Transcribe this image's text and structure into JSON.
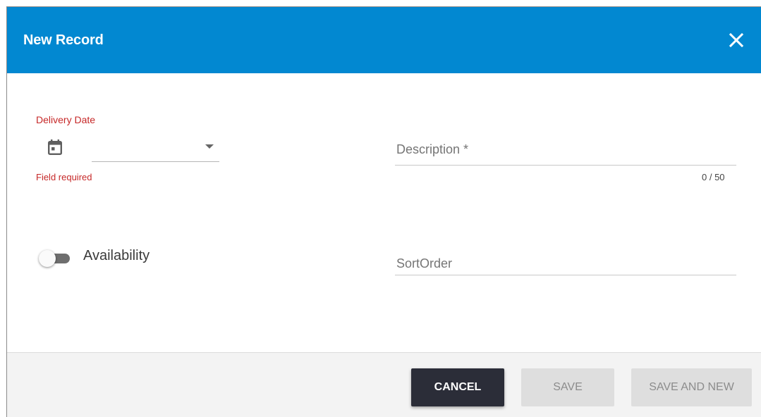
{
  "dialog": {
    "title": "New Record",
    "close_icon": "close-icon",
    "header_color": "#0288d1"
  },
  "form": {
    "delivery_date": {
      "label": "Delivery Date",
      "icon": "calendar-icon",
      "value": "",
      "error": "Field required"
    },
    "description": {
      "placeholder": "Description *",
      "value": "",
      "counter": "0 / 50"
    },
    "availability": {
      "label": "Availability",
      "checked": false
    },
    "sort_order": {
      "placeholder": "SortOrder",
      "value": ""
    }
  },
  "footer": {
    "cancel_label": "CANCEL",
    "save_label": "SAVE",
    "save_and_new_label": "SAVE AND NEW"
  },
  "colors": {
    "error": "#c62828",
    "primary": "#0288d1",
    "cancel_button": "#2b2d38",
    "disabled_button": "#dedede"
  }
}
